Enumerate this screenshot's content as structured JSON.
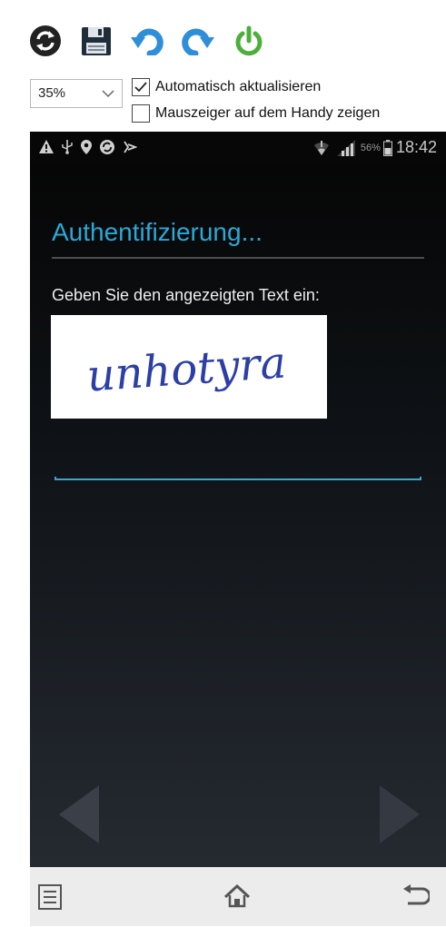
{
  "toolbar": {
    "buttons": [
      {
        "icon": "refresh-icon",
        "color": "#222222"
      },
      {
        "icon": "save-icon",
        "color": "#1f2d3a"
      },
      {
        "icon": "rotate-left-icon",
        "color": "#2e8fd8"
      },
      {
        "icon": "rotate-right-icon",
        "color": "#2e8fd8"
      },
      {
        "icon": "power-icon",
        "color": "#4caf3a"
      }
    ],
    "zoom": {
      "selected": "35%"
    },
    "auto_refresh": {
      "label": "Automatisch aktualisieren",
      "checked": true
    },
    "show_pointer": {
      "label": "Mauszeiger auf dem Handy zeigen",
      "checked": false
    }
  },
  "phone": {
    "statusbar": {
      "left_icons": [
        "warning-icon",
        "usb-icon",
        "location-icon",
        "sync-icon",
        "voicemail-icon"
      ],
      "battery_percent": "56%",
      "time": "18:42"
    },
    "dialog": {
      "title": "Authentifizierung...",
      "prompt": "Geben Sie den angezeigten Text ein:",
      "captcha_text": "unhotyra",
      "input_value": ""
    },
    "accent_color": "#2aa9d8",
    "navbar": [
      "menu-icon",
      "home-icon",
      "back-icon"
    ]
  }
}
